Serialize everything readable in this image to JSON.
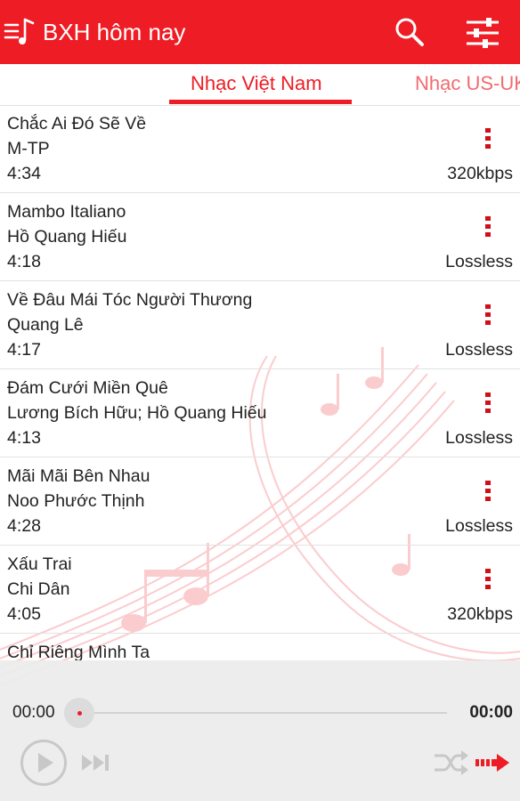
{
  "appbar": {
    "title": "BXH hôm nay",
    "icons": [
      "playlist-menu-icon",
      "search-icon",
      "equalizer-icon"
    ]
  },
  "tabs": [
    {
      "label": "Nhạc Việt Nam",
      "active": true
    },
    {
      "label": "Nhạc US-UK",
      "active": false
    }
  ],
  "songs": [
    {
      "title": "Chắc Ai Đó Sẽ Về",
      "artist": "M-TP",
      "duration": "4:34",
      "quality": "320kbps"
    },
    {
      "title": "Mambo Italiano",
      "artist": "Hồ Quang Hiếu",
      "duration": "4:18",
      "quality": "Lossless"
    },
    {
      "title": "Về Đâu Mái Tóc Người Thương",
      "artist": "Quang Lê",
      "duration": "4:17",
      "quality": "Lossless"
    },
    {
      "title": "Đám Cưới Miền Quê",
      "artist": "Lương Bích Hữu; Hồ Quang Hiếu",
      "duration": "4:13",
      "quality": "Lossless"
    },
    {
      "title": "Mãi Mãi Bên Nhau",
      "artist": "Noo Phước Thịnh",
      "duration": "4:28",
      "quality": "Lossless"
    },
    {
      "title": "Xấu Trai",
      "artist": "Chi Dân",
      "duration": "4:05",
      "quality": "320kbps"
    },
    {
      "title": "Chỉ Riêng Mình Ta",
      "artist": "",
      "duration": "",
      "quality": ""
    }
  ],
  "player": {
    "current_time": "00:00",
    "total_time": "00:00",
    "progress": 0
  },
  "colors": {
    "accent": "#ee1c24",
    "inactive_tab": "#f26b70",
    "player_bg": "#ececec"
  }
}
